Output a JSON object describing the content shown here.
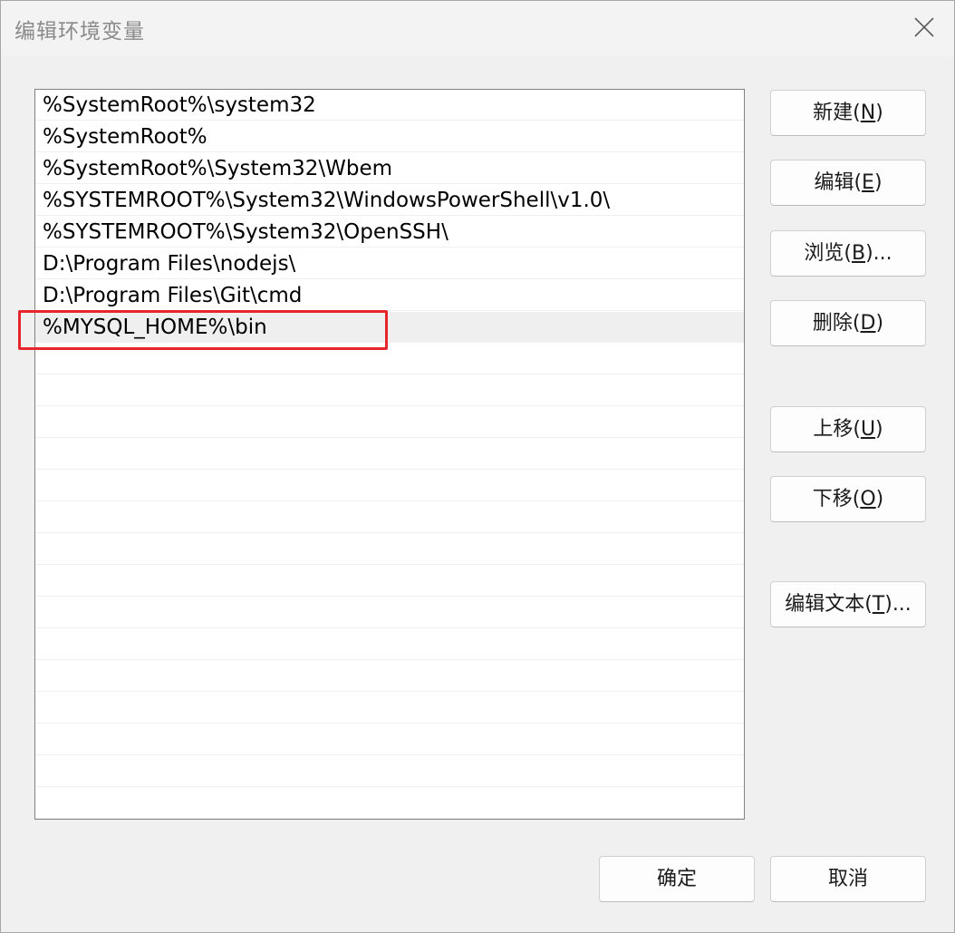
{
  "dialog": {
    "title": "编辑环境变量"
  },
  "path_list": {
    "items": [
      "%SystemRoot%\\system32",
      "%SystemRoot%",
      "%SystemRoot%\\System32\\Wbem",
      "%SYSTEMROOT%\\System32\\WindowsPowerShell\\v1.0\\",
      "%SYSTEMROOT%\\System32\\OpenSSH\\",
      "D:\\Program Files\\nodejs\\",
      "D:\\Program Files\\Git\\cmd",
      "%MYSQL_HOME%\\bin"
    ],
    "selected_index": 7,
    "highlight_color": "#e5262c"
  },
  "buttons": {
    "new": {
      "text": "新建(",
      "key": "N",
      "suffix": ")"
    },
    "edit": {
      "text": "编辑(",
      "key": "E",
      "suffix": ")"
    },
    "browse": {
      "text": "浏览(",
      "key": "B",
      "suffix": ")..."
    },
    "delete": {
      "text": "删除(",
      "key": "D",
      "suffix": ")"
    },
    "move_up": {
      "text": "上移(",
      "key": "U",
      "suffix": ")"
    },
    "move_down": {
      "text": "下移(",
      "key": "O",
      "suffix": ")"
    },
    "edit_text": {
      "text": "编辑文本(",
      "key": "T",
      "suffix": ")..."
    },
    "ok": {
      "label": "确定"
    },
    "cancel": {
      "label": "取消"
    }
  },
  "icons": {
    "close": "close-icon"
  }
}
